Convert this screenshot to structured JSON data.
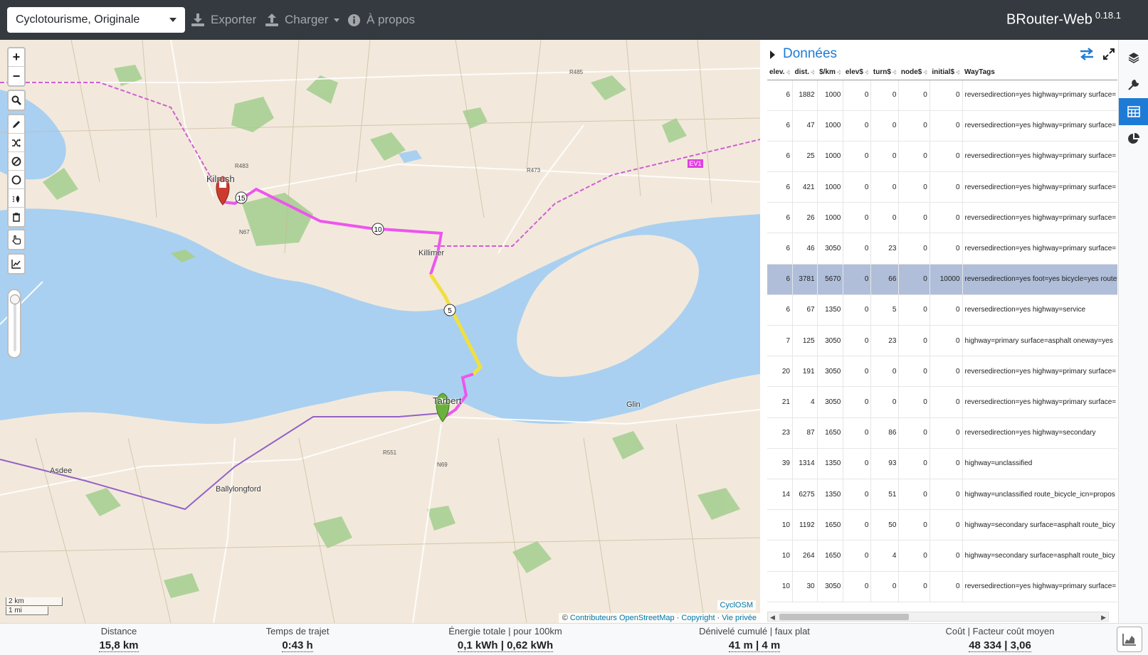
{
  "navbar": {
    "profile": "Cyclotourisme, Originale",
    "export_label": "Exporter",
    "load_label": "Charger",
    "about_label": "À propos",
    "brand": "BRouter-Web",
    "version": "0.18.1"
  },
  "map": {
    "labels": {
      "kilrush": "Kilrush",
      "killimer": "Killimer",
      "tarbert": "Tarbert",
      "glin": "Glin",
      "asdee": "Asdee",
      "ballylongford": "Ballylongford",
      "ev1": "EV1",
      "r473": "R473",
      "r485": "R485",
      "r551": "R551",
      "n67": "N67",
      "n69": "N69",
      "r483": "R483"
    },
    "waypoints": [
      "15",
      "10",
      "5"
    ],
    "scale_km": "2 km",
    "scale_mi": "1 mi",
    "layer_name": "CyclOSM",
    "attribution_prefix": "©",
    "attribution_link": "Contributeurs OpenStreetMap",
    "attribution_copyright": "Copyright",
    "attribution_privacy": "Vie privée"
  },
  "colors": {
    "water": "#a9d0f0",
    "route_magenta": "#ee55ee",
    "route_ferry": "#f0e040",
    "accent": "#1d7bd6",
    "selected_row": "#b0bed9"
  },
  "panel": {
    "title": "Données",
    "columns": [
      "elev.",
      "dist.",
      "$/km",
      "elev$",
      "turn$",
      "node$",
      "initial$",
      "WayTags"
    ],
    "rows": [
      [
        "6",
        "1882",
        "1000",
        "0",
        "0",
        "0",
        "0",
        "reversedirection=yes highway=primary surface="
      ],
      [
        "6",
        "47",
        "1000",
        "0",
        "0",
        "0",
        "0",
        "reversedirection=yes highway=primary surface="
      ],
      [
        "6",
        "25",
        "1000",
        "0",
        "0",
        "0",
        "0",
        "reversedirection=yes highway=primary surface="
      ],
      [
        "6",
        "421",
        "1000",
        "0",
        "0",
        "0",
        "0",
        "reversedirection=yes highway=primary surface="
      ],
      [
        "6",
        "26",
        "1000",
        "0",
        "0",
        "0",
        "0",
        "reversedirection=yes highway=primary surface="
      ],
      [
        "6",
        "46",
        "3050",
        "0",
        "23",
        "0",
        "0",
        "reversedirection=yes highway=primary surface="
      ],
      [
        "6",
        "3781",
        "5670",
        "0",
        "66",
        "0",
        "10000",
        "reversedirection=yes foot=yes bicycle=yes route"
      ],
      [
        "6",
        "67",
        "1350",
        "0",
        "5",
        "0",
        "0",
        "reversedirection=yes highway=service"
      ],
      [
        "7",
        "125",
        "3050",
        "0",
        "23",
        "0",
        "0",
        "highway=primary surface=asphalt oneway=yes"
      ],
      [
        "20",
        "191",
        "3050",
        "0",
        "0",
        "0",
        "0",
        "reversedirection=yes highway=primary surface="
      ],
      [
        "21",
        "4",
        "3050",
        "0",
        "0",
        "0",
        "0",
        "reversedirection=yes highway=primary surface="
      ],
      [
        "23",
        "87",
        "1650",
        "0",
        "86",
        "0",
        "0",
        "reversedirection=yes highway=secondary"
      ],
      [
        "39",
        "1314",
        "1350",
        "0",
        "93",
        "0",
        "0",
        "highway=unclassified"
      ],
      [
        "14",
        "6275",
        "1350",
        "0",
        "51",
        "0",
        "0",
        "highway=unclassified route_bicycle_icn=propos"
      ],
      [
        "10",
        "1192",
        "1650",
        "0",
        "50",
        "0",
        "0",
        "highway=secondary surface=asphalt route_bicy"
      ],
      [
        "10",
        "264",
        "1650",
        "0",
        "4",
        "0",
        "0",
        "highway=secondary surface=asphalt route_bicy"
      ],
      [
        "10",
        "30",
        "3050",
        "0",
        "0",
        "0",
        "0",
        "reversedirection=yes highway=primary surface="
      ]
    ],
    "selected_row": 6
  },
  "footer": {
    "distance_label": "Distance",
    "distance_value": "15,8 km",
    "time_label": "Temps de trajet",
    "time_value": "0:43 h",
    "energy_label": "Énergie totale | pour 100km",
    "energy_value": "0,1 kWh | 0,62 kWh",
    "ascent_label": "Dénivelé cumulé | faux plat",
    "ascent_value": "41 m | 4 m",
    "cost_label": "Coût | Facteur coût moyen",
    "cost_value": "48 334 | 3,06"
  }
}
